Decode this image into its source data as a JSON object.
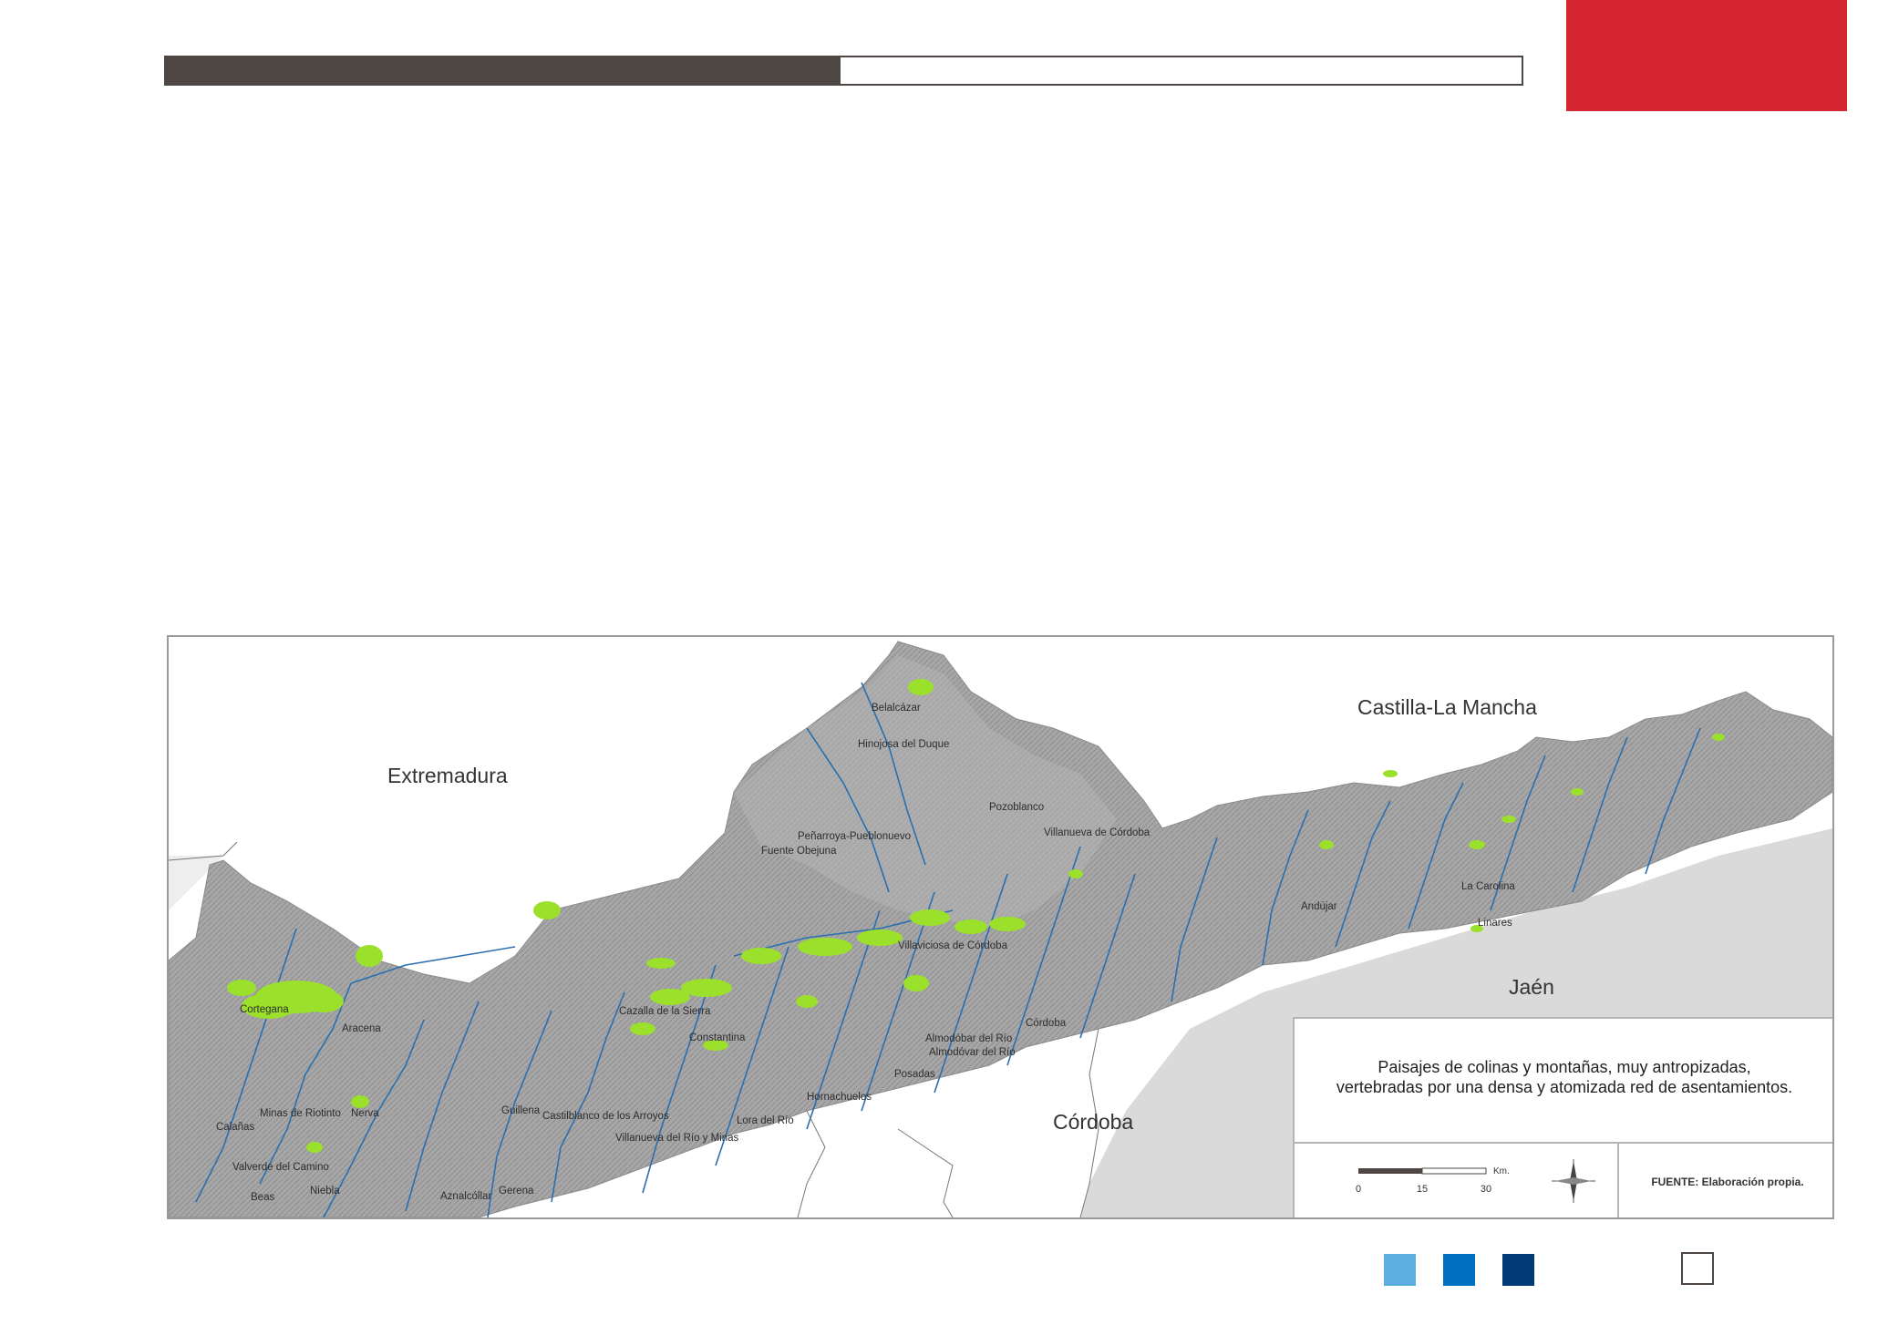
{
  "header": {
    "progress": 0.4975,
    "bar_color": "#4d4643",
    "accent_color": "#d42530"
  },
  "map": {
    "regions": {
      "extremadura": "Extremadura",
      "castilla": "Castilla-La Mancha",
      "jaen": "Jaén",
      "cordoba_province": "Córdoba"
    },
    "towns": [
      {
        "name": "Belalcázar"
      },
      {
        "name": "Hinojosa del Duque"
      },
      {
        "name": "Pozoblanco"
      },
      {
        "name": "Villanueva de Córdoba"
      },
      {
        "name": "Peñarroya-Pueblonuevo"
      },
      {
        "name": "Fuente Obejuna"
      },
      {
        "name": "Villaviciosa de Córdoba"
      },
      {
        "name": "La Carolina"
      },
      {
        "name": "Linares"
      },
      {
        "name": "Andújar"
      },
      {
        "name": "Cortegana"
      },
      {
        "name": "Aracena"
      },
      {
        "name": "Cazalla de la Sierra"
      },
      {
        "name": "Constantina"
      },
      {
        "name": "Almodóbar del Río"
      },
      {
        "name": "Almodóvar del Río"
      },
      {
        "name": "Córdoba"
      },
      {
        "name": "Posadas"
      },
      {
        "name": "Hornachuelos"
      },
      {
        "name": "Lora del Río"
      },
      {
        "name": "Villanueva del Río y Minas"
      },
      {
        "name": "Castilblanco de los Arroyos"
      },
      {
        "name": "Guillena"
      },
      {
        "name": "Minas de Riotinto"
      },
      {
        "name": "Nerva"
      },
      {
        "name": "Calañas"
      },
      {
        "name": "Valverde del Camino"
      },
      {
        "name": "Beas"
      },
      {
        "name": "Niebla"
      },
      {
        "name": "Aznalcóllar"
      },
      {
        "name": "Gerena"
      }
    ],
    "colors": {
      "terrain": "#a9a9a9",
      "outside": "#dcdcdc",
      "rivers": "#2a6fb0",
      "highlight": "#9be02a"
    }
  },
  "legend": {
    "title_line1": "Paisajes de colinas y montañas, muy antropizadas,",
    "title_line2": "vertebradas por una densa y atomizada red de asentamientos.",
    "scale_ticks": [
      "0",
      "15",
      "30"
    ],
    "scale_unit": "Km.",
    "source": "FUENTE: Elaboración propia.",
    "compass_icon": "north-arrow"
  },
  "footer": {
    "squares": [
      "#5aaee0",
      "#0070c0",
      "#003a78"
    ]
  }
}
